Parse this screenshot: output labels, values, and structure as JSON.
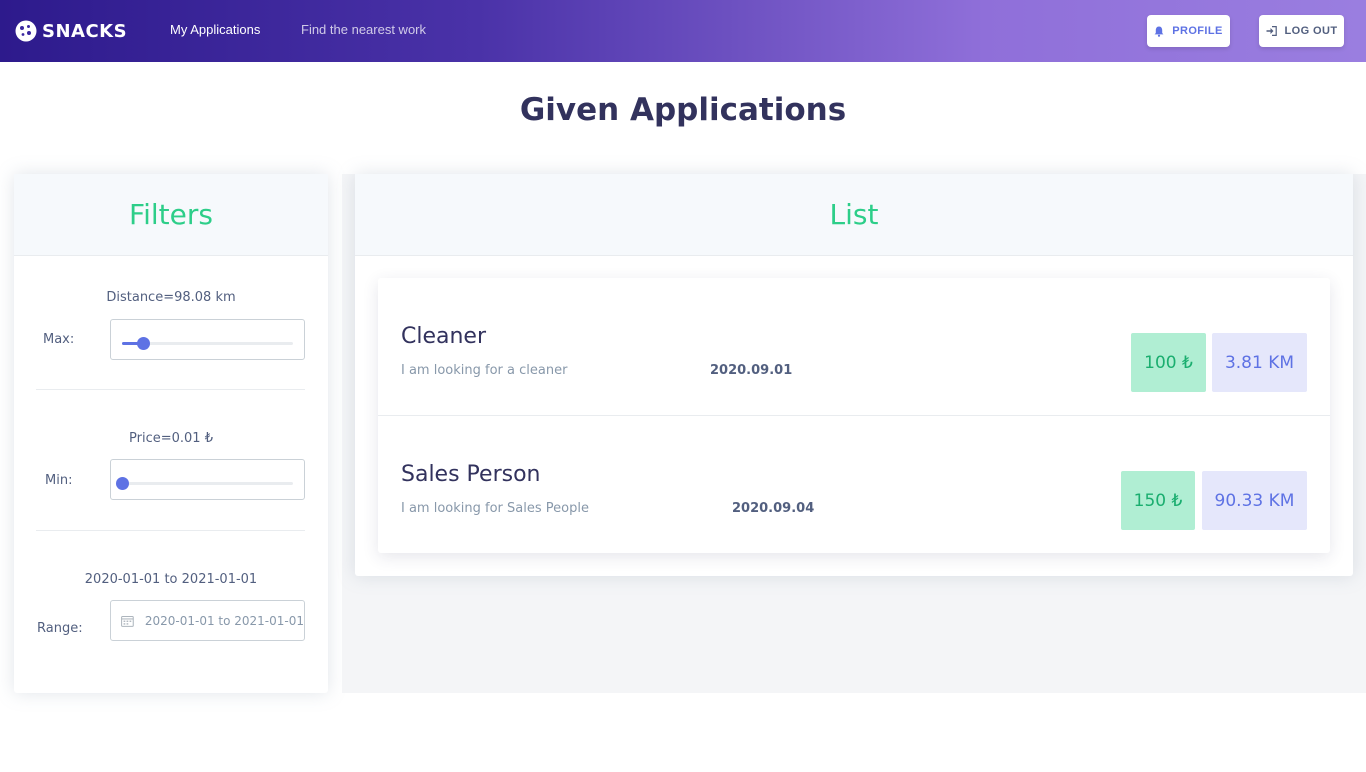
{
  "navbar": {
    "brand": "SNACKS",
    "links": [
      {
        "label": "My Applications"
      },
      {
        "label": "Find the nearest work"
      }
    ],
    "profile_label": "PROFILE",
    "logout_label": "LOG OUT"
  },
  "page_title": "Given Applications",
  "filters": {
    "header": "Filters",
    "distance": {
      "caption": "Distance=98.08 km",
      "label": "Max:",
      "level": 0.12
    },
    "price": {
      "caption": "Price=0.01 ₺",
      "label": "Min:",
      "level": 0.0
    },
    "range": {
      "caption": "2020-01-01 to 2021-01-01",
      "label": "Range:",
      "value": "2020-01-01 to 2021-01-01"
    }
  },
  "list": {
    "header": "List",
    "items": [
      {
        "title": "Cleaner",
        "description": "I am looking for a cleaner",
        "date": "2020.09.01",
        "price": "100 ₺",
        "distance": "3.81 KM"
      },
      {
        "title": "Sales Person",
        "description": "I am looking for Sales People",
        "date": "2020.09.04",
        "price": "150 ₺",
        "distance": "90.33 KM"
      }
    ]
  },
  "colors": {
    "accent": "#5e72e4",
    "success": "#2dce89",
    "price_badge_bg": "#b0eed3",
    "distance_badge_bg": "#e5e7fb"
  }
}
